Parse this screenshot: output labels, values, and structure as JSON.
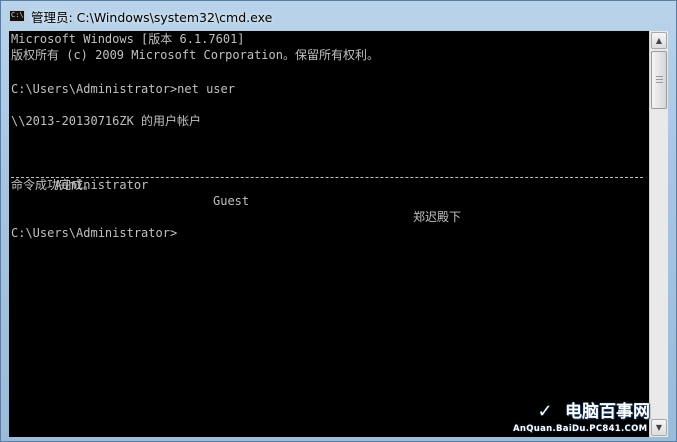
{
  "window": {
    "title": "管理员: C:\\Windows\\system32\\cmd.exe",
    "icon": "cmd-icon"
  },
  "console": {
    "lines": [
      "Microsoft Windows [版本 6.1.7601]",
      "版权所有 (c) 2009 Microsoft Corporation。保留所有权利。",
      "",
      "C:\\Users\\Administrator>net user",
      "",
      "\\\\2013-20130716ZK 的用户帐户",
      ""
    ],
    "users": [
      "Administrator",
      "Guest",
      "郑迟殿下"
    ],
    "result": "命令成功完成。",
    "prompt": "C:\\Users\\Administrator>",
    "text_color": "#c0c0c0",
    "background": "#000000"
  },
  "watermark": {
    "brand": "电脑百事网",
    "url": "AnQuan.BaiDu.PC841.COM"
  }
}
